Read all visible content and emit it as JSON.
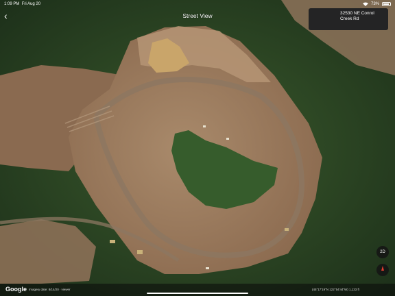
{
  "status_bar": {
    "time": "1:09 PM",
    "date": "Fri Aug 20",
    "battery": "73%",
    "battery_level": 0.73
  },
  "header": {
    "title": "Street View",
    "back_icon": "chevron-left-icon"
  },
  "address_card": {
    "line1": "32530 NE Conrol",
    "line2": "Creek Rd"
  },
  "map_controls": {
    "two_d_label": "2D",
    "compass_icon": "compass-icon"
  },
  "footer": {
    "logo": "Google",
    "imagery_date": "Imagery date: 8/14/20 ∙ viewer",
    "coordinates": "(45°17'19\"N 122°54'44\"W) 1,133 ft"
  },
  "colors": {
    "forest": "#2d4a24",
    "bare_soil": "#9a7a5a",
    "pond": "#c9a56a",
    "road": "#8c7762"
  }
}
